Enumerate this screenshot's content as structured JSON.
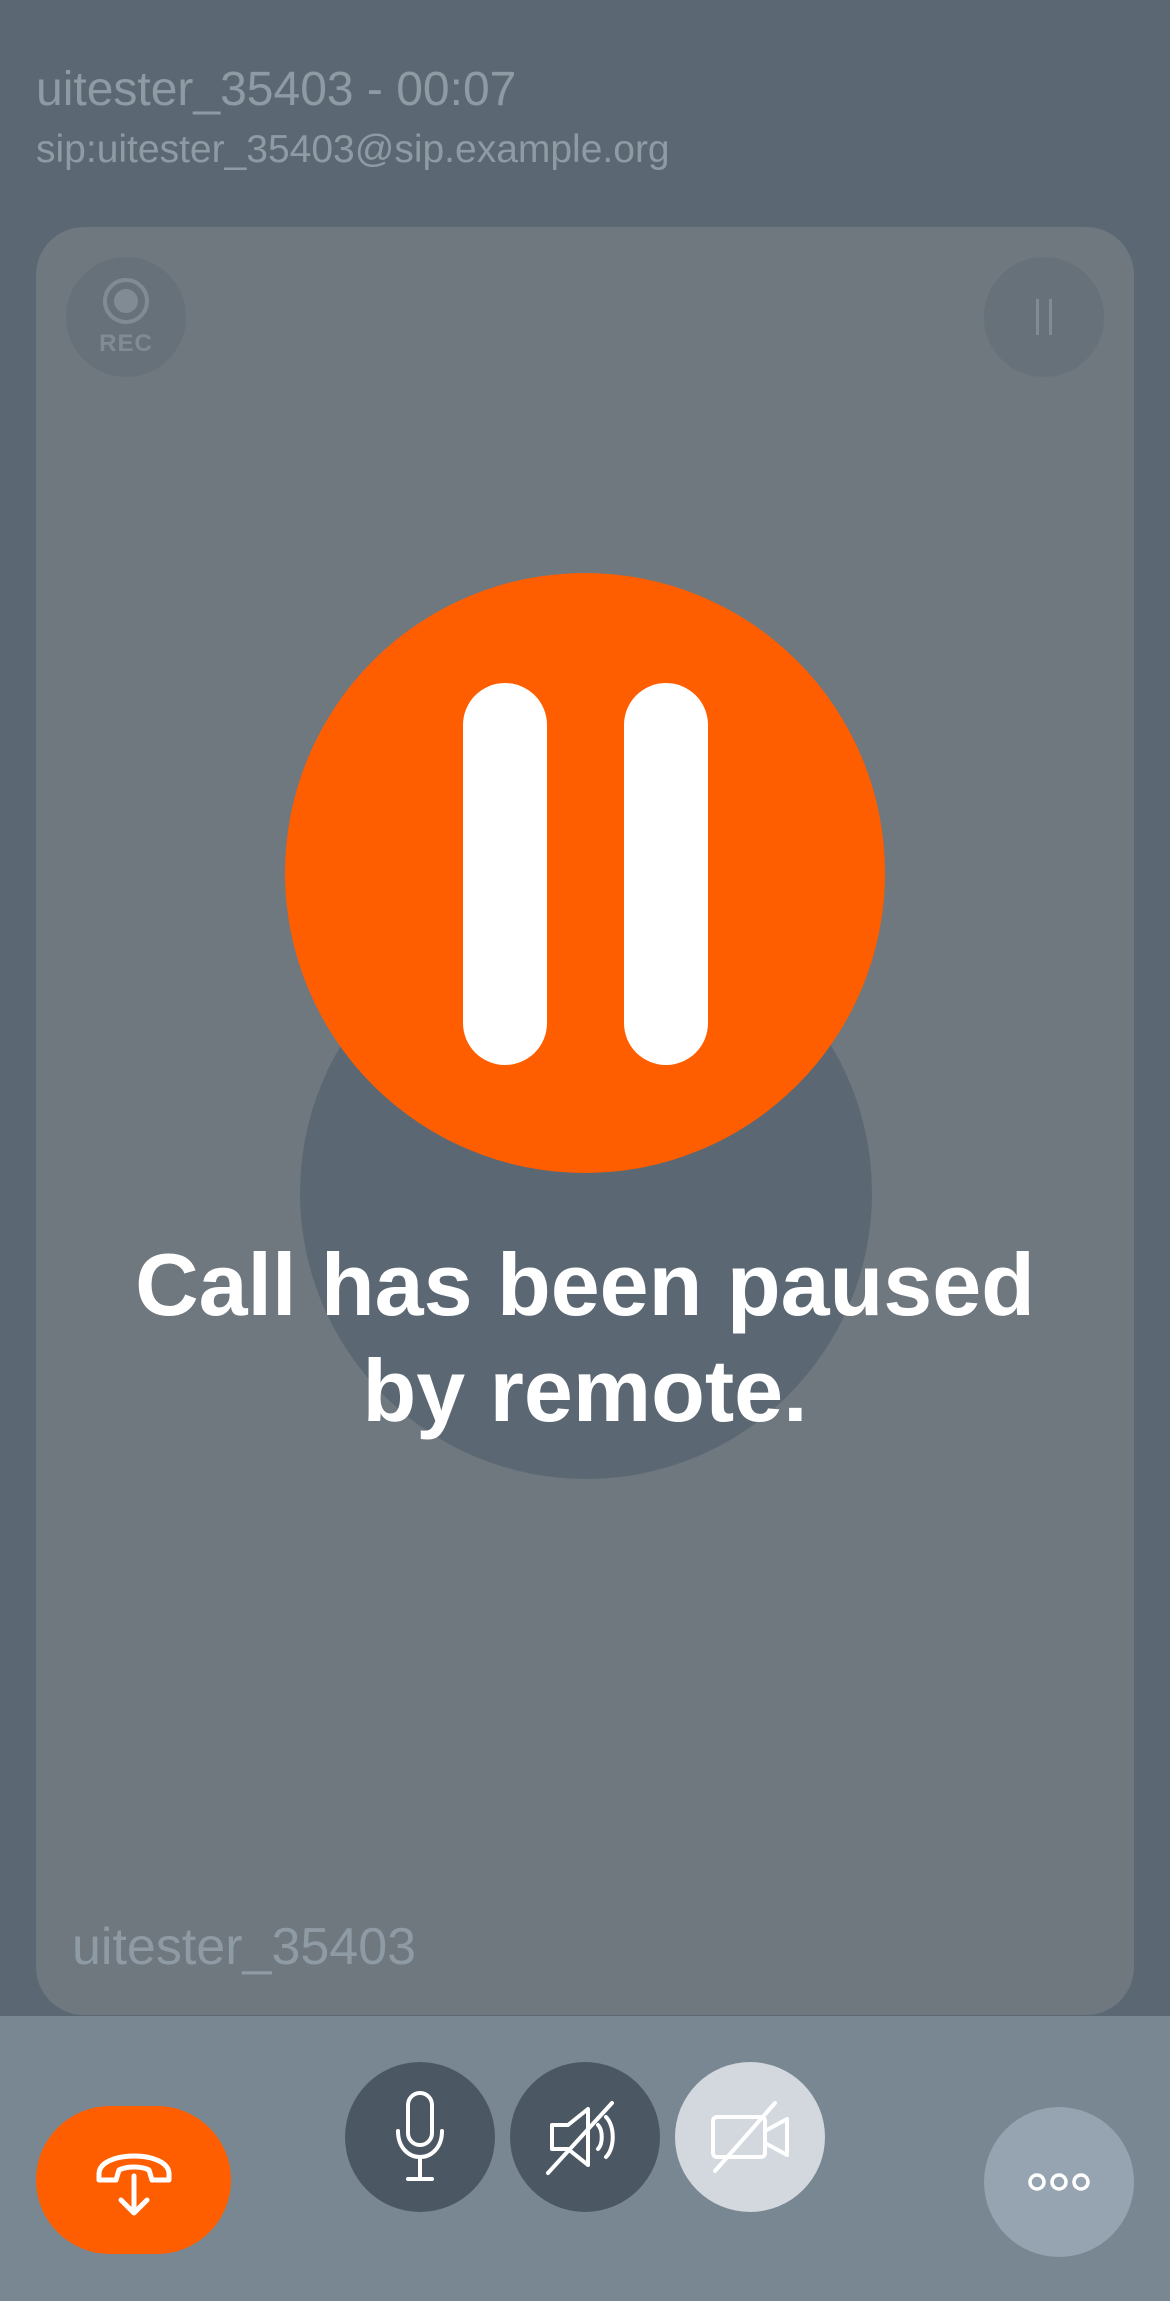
{
  "header": {
    "title": "uitester_35403 - 00:07",
    "address": "sip:uitester_35403@sip.example.org"
  },
  "tile": {
    "participant_name": "uitester_35403",
    "rec_label": "REC"
  },
  "paused": {
    "message_line1": "Call has been paused",
    "message_line2": "by remote."
  },
  "controls": {
    "hangup_icon": "hangup-icon",
    "microphone_icon": "microphone-icon",
    "speaker_icon": "speaker-muted-icon",
    "camera_icon": "camera-off-icon",
    "more_icon": "more-icon"
  },
  "colors": {
    "background": "#5b6873",
    "accent": "#ff5e00",
    "tile": "#6f777f",
    "bottom_bar": "#788792"
  }
}
